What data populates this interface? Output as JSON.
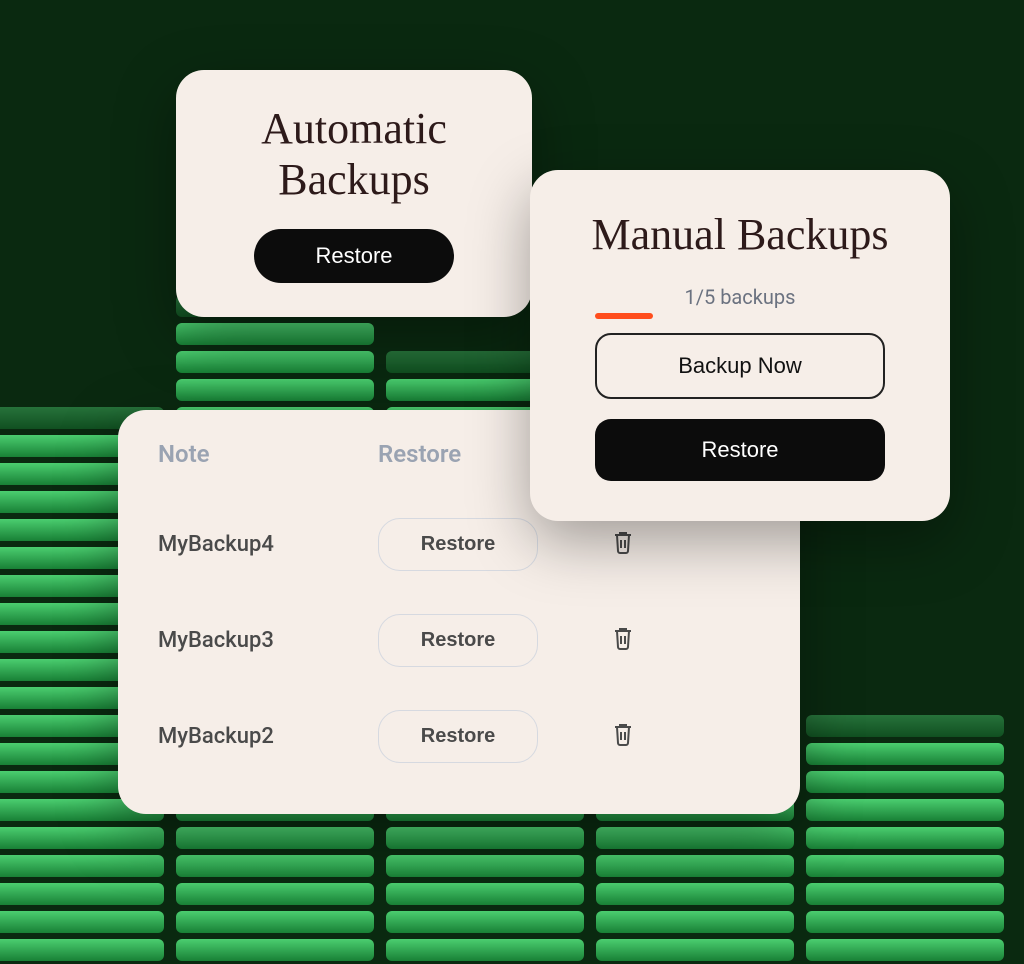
{
  "automatic": {
    "title": "Automatic Backups",
    "restore_label": "Restore"
  },
  "manual": {
    "title": "Manual Backups",
    "count_label": "1/5 backups",
    "backup_now_label": "Backup Now",
    "restore_label": "Restore"
  },
  "list": {
    "headers": {
      "note": "Note",
      "restore": "Restore"
    },
    "rows": [
      {
        "note": "MyBackup4",
        "restore_label": "Restore"
      },
      {
        "note": "MyBackup3",
        "restore_label": "Restore"
      },
      {
        "note": "MyBackup2",
        "restore_label": "Restore"
      }
    ]
  }
}
